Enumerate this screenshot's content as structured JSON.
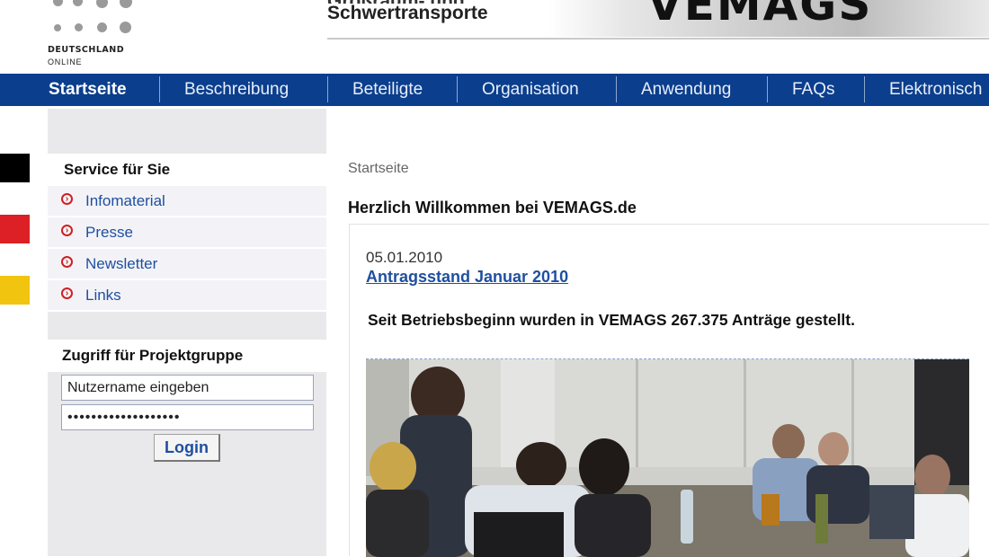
{
  "header": {
    "logo_line1": "DEUTSCHLAND",
    "logo_line2": "ONLINE",
    "tagline_line1": "Großraum- und",
    "tagline_line2": "Schwertransporte",
    "banner_text": "VEMAGS"
  },
  "nav": {
    "items": [
      "Startseite",
      "Beschreibung",
      "Beteiligte",
      "Organisation",
      "Anwendung",
      "FAQs",
      "Elektronisch"
    ],
    "active_index": 0
  },
  "sidebar": {
    "service_title": "Service für Sie",
    "links": [
      "Infomaterial",
      "Presse",
      "Newsletter",
      "Links"
    ],
    "login_title": "Zugriff für Projektgruppe",
    "username_value": "Nutzername eingeben",
    "password_value": "•••••••••••••••••••",
    "login_button": "Login"
  },
  "content": {
    "breadcrumb": "Startseite",
    "welcome": "Herzlich Willkommen bei VEMAGS.de",
    "news_date": "05.01.2010",
    "news_link": "Antragsstand Januar 2010",
    "news_text": "Seit Betriebsbeginn wurden in VEMAGS 267.375 Anträge gestellt."
  },
  "colors": {
    "nav_bg": "#0b3e8c",
    "link": "#1f4fa0",
    "flag": [
      "#000000",
      "#dd1f26",
      "#f1c40f"
    ]
  }
}
